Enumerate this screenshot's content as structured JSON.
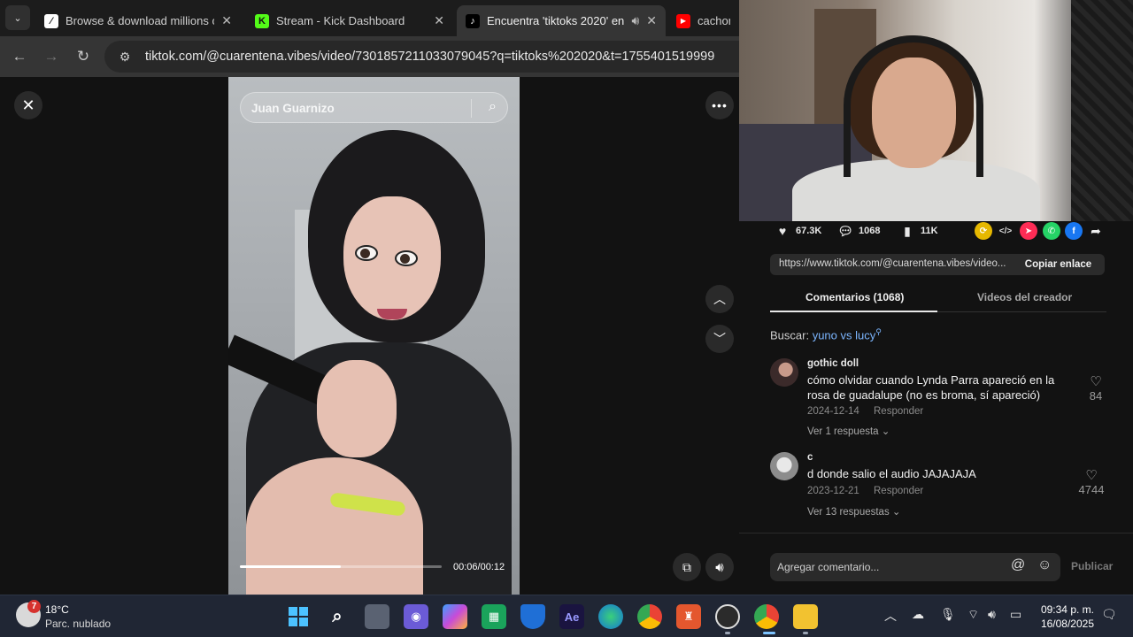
{
  "browser": {
    "tabs": [
      {
        "title": "Browse & download millions of",
        "favicon": "slash-icon",
        "close": "✕"
      },
      {
        "title": "Stream - Kick Dashboard",
        "favicon": "K",
        "close": "✕"
      },
      {
        "title": "Encuentra 'tiktoks 2020' en",
        "favicon": "tiktok-icon",
        "close": "✕",
        "active": true
      },
      {
        "title": "cachondo",
        "favicon": "youtube-icon"
      }
    ],
    "url": "tiktok.com/@cuarentena.vibes/video/7301857211033079045?q=tiktoks%202020&t=1755401519999"
  },
  "video": {
    "search_placeholder": "Juan Guarnizo",
    "progress": 0.5,
    "timecode": "00:06/00:12"
  },
  "stats": {
    "likes": "67.3K",
    "comments": "1068",
    "saves": "11K"
  },
  "share_link": {
    "url": "https://www.tiktok.com/@cuarentena.vibes/video...",
    "copy_label": "Copiar enlace"
  },
  "tabs": {
    "comments": "Comentarios (1068)",
    "creator": "Videos del creador"
  },
  "search_hint": {
    "label": "Buscar:",
    "query": "yuno vs lucy"
  },
  "comments": [
    {
      "author": "gothic doll",
      "text": "cómo olvidar cuando Lynda Parra apareció en la rosa de guadalupe (no es broma, sí apareció)",
      "date": "2024-12-14",
      "reply": "Responder",
      "more": "Ver 1 respuesta",
      "likes": "84"
    },
    {
      "author": "c",
      "text": "d donde salio el audio JAJAJAJA",
      "date": "2023-12-21",
      "reply": "Responder",
      "more": "Ver 13 respuestas",
      "likes": "4744"
    }
  ],
  "comment_box": {
    "placeholder": "Agregar comentario...",
    "publish": "Publicar"
  },
  "taskbar": {
    "weather_temp": "18°C",
    "weather_desc": "Parc. nublado",
    "weather_badge": "7",
    "time": "09:34 p. m.",
    "date": "16/08/2025"
  },
  "colors": {
    "accent_link": "#7cb6ff",
    "tiktok_bg": "#121212",
    "taskbar": "#202634"
  }
}
